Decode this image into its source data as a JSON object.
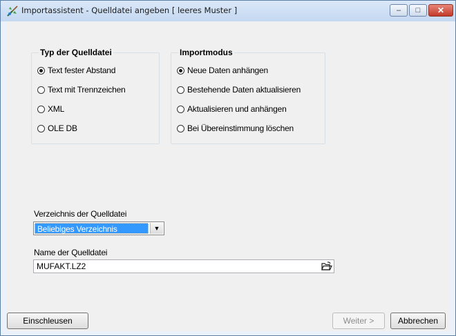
{
  "window": {
    "title": "Importassistent - Quelldatei angeben [ leeres Muster ]",
    "icon": "wizard-app-icon",
    "controls": {
      "minimize": "–",
      "maximize": "□",
      "close": "✕"
    }
  },
  "source_type": {
    "title": "Typ der Quelldatei",
    "options": [
      {
        "label": "Text fester Abstand",
        "checked": true
      },
      {
        "label": "Text mit Trennzeichen",
        "checked": false
      },
      {
        "label": "XML",
        "checked": false
      },
      {
        "label": "OLE DB",
        "checked": false
      }
    ]
  },
  "import_mode": {
    "title": "Importmodus",
    "options": [
      {
        "label": "Neue Daten anhängen",
        "checked": true
      },
      {
        "label": "Bestehende Daten aktualisieren",
        "checked": false
      },
      {
        "label": "Aktualisieren und anhängen",
        "checked": false
      },
      {
        "label": "Bei Übereinstimmung löschen",
        "checked": false
      }
    ]
  },
  "directory": {
    "label": "Verzeichnis der Quelldatei",
    "value": "Beliebiges Verzeichnis"
  },
  "filename": {
    "label": "Name der Quelldatei",
    "value": "MUFAKT.LZ2"
  },
  "buttons": {
    "einschleusen": "Einschleusen",
    "weiter": "Weiter >",
    "abbrechen": "Abbrechen"
  }
}
